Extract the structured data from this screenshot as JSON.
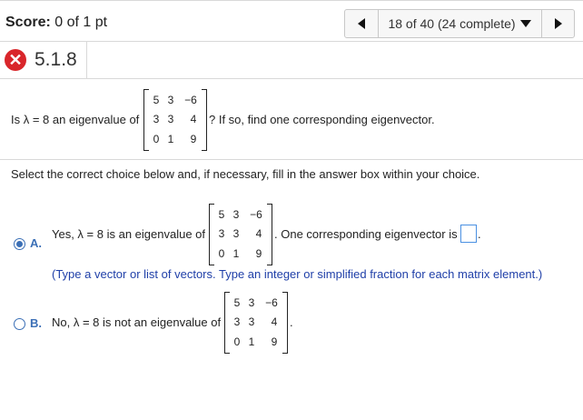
{
  "header": {
    "score_label": "Score:",
    "score_value": "0 of 1 pt",
    "nav_status": "18 of 40 (24 complete)"
  },
  "question": {
    "number": "5.1.8",
    "status_icon": "x-icon",
    "prompt_before": "Is λ = 8 an eigenvalue of",
    "prompt_after": "? If so, find one corresponding eigenvector.",
    "matrix": [
      [
        "5",
        "3",
        "−6"
      ],
      [
        "3",
        "3",
        "4"
      ],
      [
        "0",
        "1",
        "9"
      ]
    ]
  },
  "instructions": "Select the correct choice below and, if necessary, fill in the answer box within your choice.",
  "options": {
    "a": {
      "label": "A.",
      "text_before": "Yes, λ = 8 is an eigenvalue of",
      "text_after": ". One corresponding eigenvector is",
      "answer_value": "",
      "period": ".",
      "hint": "(Type a vector or list of vectors. Type an integer or simplified fraction for each matrix element.)",
      "selected": true
    },
    "b": {
      "label": "B.",
      "text_before": "No, λ = 8 is not an eigenvalue of",
      "text_after": ".",
      "selected": false
    }
  },
  "colors": {
    "accent": "#3b6fb6",
    "error": "#d9262b",
    "hint": "#1f3fa8"
  }
}
